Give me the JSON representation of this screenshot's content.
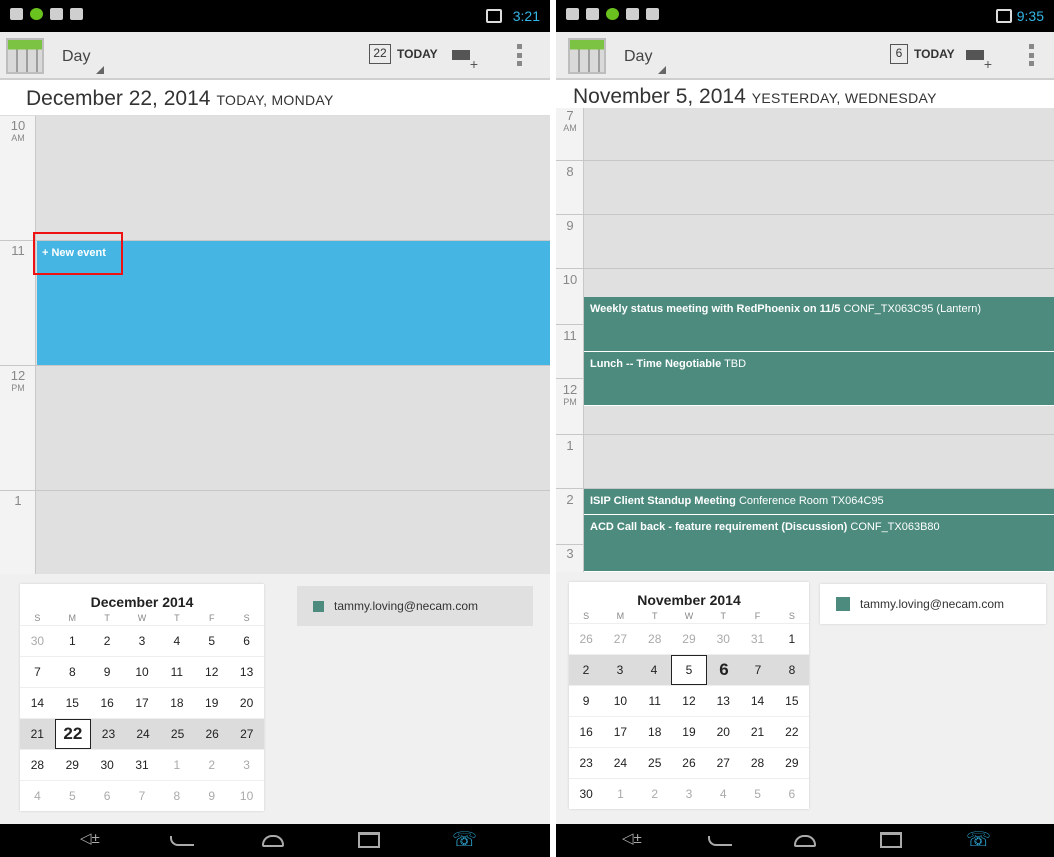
{
  "left": {
    "status": {
      "time": "3:21"
    },
    "actionbar": {
      "view": "Day",
      "today_date": "22",
      "today_label": "TODAY"
    },
    "date_header": {
      "date": "December 22, 2014",
      "sub": "TODAY, MONDAY"
    },
    "hours": [
      {
        "h": "10",
        "ampm": "AM"
      },
      {
        "h": "11",
        "ampm": ""
      },
      {
        "h": "12",
        "ampm": "PM"
      },
      {
        "h": "1",
        "ampm": ""
      }
    ],
    "new_event": "+ New event",
    "mini": {
      "title": "December 2014",
      "dow": [
        "S",
        "M",
        "T",
        "W",
        "T",
        "F",
        "S"
      ],
      "weeks": [
        [
          "30",
          "1",
          "2",
          "3",
          "4",
          "5",
          "6"
        ],
        [
          "7",
          "8",
          "9",
          "10",
          "11",
          "12",
          "13"
        ],
        [
          "14",
          "15",
          "16",
          "17",
          "18",
          "19",
          "20"
        ],
        [
          "21",
          "22",
          "23",
          "24",
          "25",
          "26",
          "27"
        ],
        [
          "28",
          "29",
          "30",
          "31",
          "1",
          "2",
          "3"
        ],
        [
          "4",
          "5",
          "6",
          "7",
          "8",
          "9",
          "10"
        ]
      ]
    },
    "account": "tammy.loving@necam.com"
  },
  "right": {
    "status": {
      "time": "9:35"
    },
    "actionbar": {
      "view": "Day",
      "today_date": "6",
      "today_label": "TODAY"
    },
    "date_header": {
      "date": "November 5, 2014",
      "sub": "YESTERDAY, WEDNESDAY"
    },
    "hours": [
      {
        "h": "7",
        "ampm": "AM"
      },
      {
        "h": "8",
        "ampm": ""
      },
      {
        "h": "9",
        "ampm": ""
      },
      {
        "h": "10",
        "ampm": ""
      },
      {
        "h": "11",
        "ampm": ""
      },
      {
        "h": "12",
        "ampm": "PM"
      },
      {
        "h": "1",
        "ampm": ""
      },
      {
        "h": "2",
        "ampm": ""
      },
      {
        "h": "3",
        "ampm": ""
      }
    ],
    "events": [
      {
        "title": "Weekly status meeting with RedPhoenix on 11/5",
        "location": "CONF_TX063C95 (Lantern)"
      },
      {
        "title": "Lunch -- Time Negotiable",
        "location": "TBD"
      },
      {
        "title": "ISIP Client Standup Meeting",
        "location": "Conference Room TX064C95"
      },
      {
        "title": "ACD Call back - feature requirement (Discussion)",
        "location": "CONF_TX063B80"
      }
    ],
    "mini": {
      "title": "November 2014",
      "dow": [
        "S",
        "M",
        "T",
        "W",
        "T",
        "F",
        "S"
      ],
      "weeks": [
        [
          "26",
          "27",
          "28",
          "29",
          "30",
          "31",
          "1"
        ],
        [
          "2",
          "3",
          "4",
          "5",
          "6",
          "7",
          "8"
        ],
        [
          "9",
          "10",
          "11",
          "12",
          "13",
          "14",
          "15"
        ],
        [
          "16",
          "17",
          "18",
          "19",
          "20",
          "21",
          "22"
        ],
        [
          "23",
          "24",
          "25",
          "26",
          "27",
          "28",
          "29"
        ],
        [
          "30",
          "1",
          "2",
          "3",
          "4",
          "5",
          "6"
        ]
      ]
    },
    "account": "tammy.loving@necam.com"
  },
  "colors": {
    "event": "#4c8b7e",
    "new_event": "#45b5e3",
    "highlight": "#e11111",
    "status_text": "#33b5e5"
  }
}
